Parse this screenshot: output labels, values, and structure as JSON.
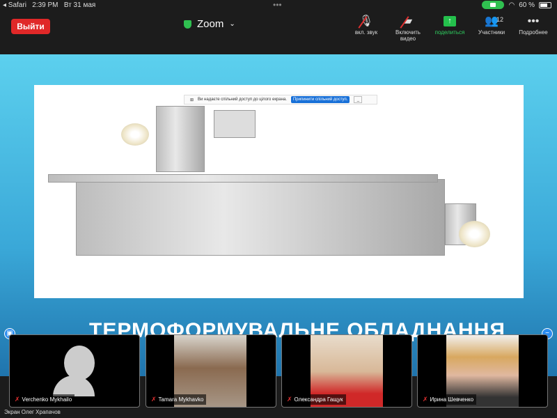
{
  "status_bar": {
    "back_app": "◂ Safari",
    "time": "2:39 PM",
    "date": "Вт 31 мая",
    "battery": "60 %"
  },
  "toolbar": {
    "leave_label": "Выйти",
    "meeting_title": "Zoom",
    "tools": [
      {
        "icon": "mic-muted-icon",
        "label": "вкл. звук"
      },
      {
        "icon": "video-off-icon",
        "label": "Включить видео"
      },
      {
        "icon": "share-icon",
        "label": "поделиться"
      },
      {
        "icon": "participants-icon",
        "label": "Участники",
        "count": "12"
      },
      {
        "icon": "more-icon",
        "label": "Подробнее"
      }
    ]
  },
  "share_bar": {
    "message": "Ви надаєте спільний доступ до цілого екрана.",
    "stop_label": "Припинити спільний доступ.",
    "minimize": "_"
  },
  "slide": {
    "title": "ТЕРМОФОРМУВАЛЬНЕ ОБЛАДНАННЯ"
  },
  "participants": [
    {
      "name": "Verchenko Mykhailo"
    },
    {
      "name": "Tamara Mykhavko"
    },
    {
      "name": "Олександра Гащук"
    },
    {
      "name": "Ирина Шевченко"
    }
  ],
  "screen_label": "Экран Олег Храпачов"
}
